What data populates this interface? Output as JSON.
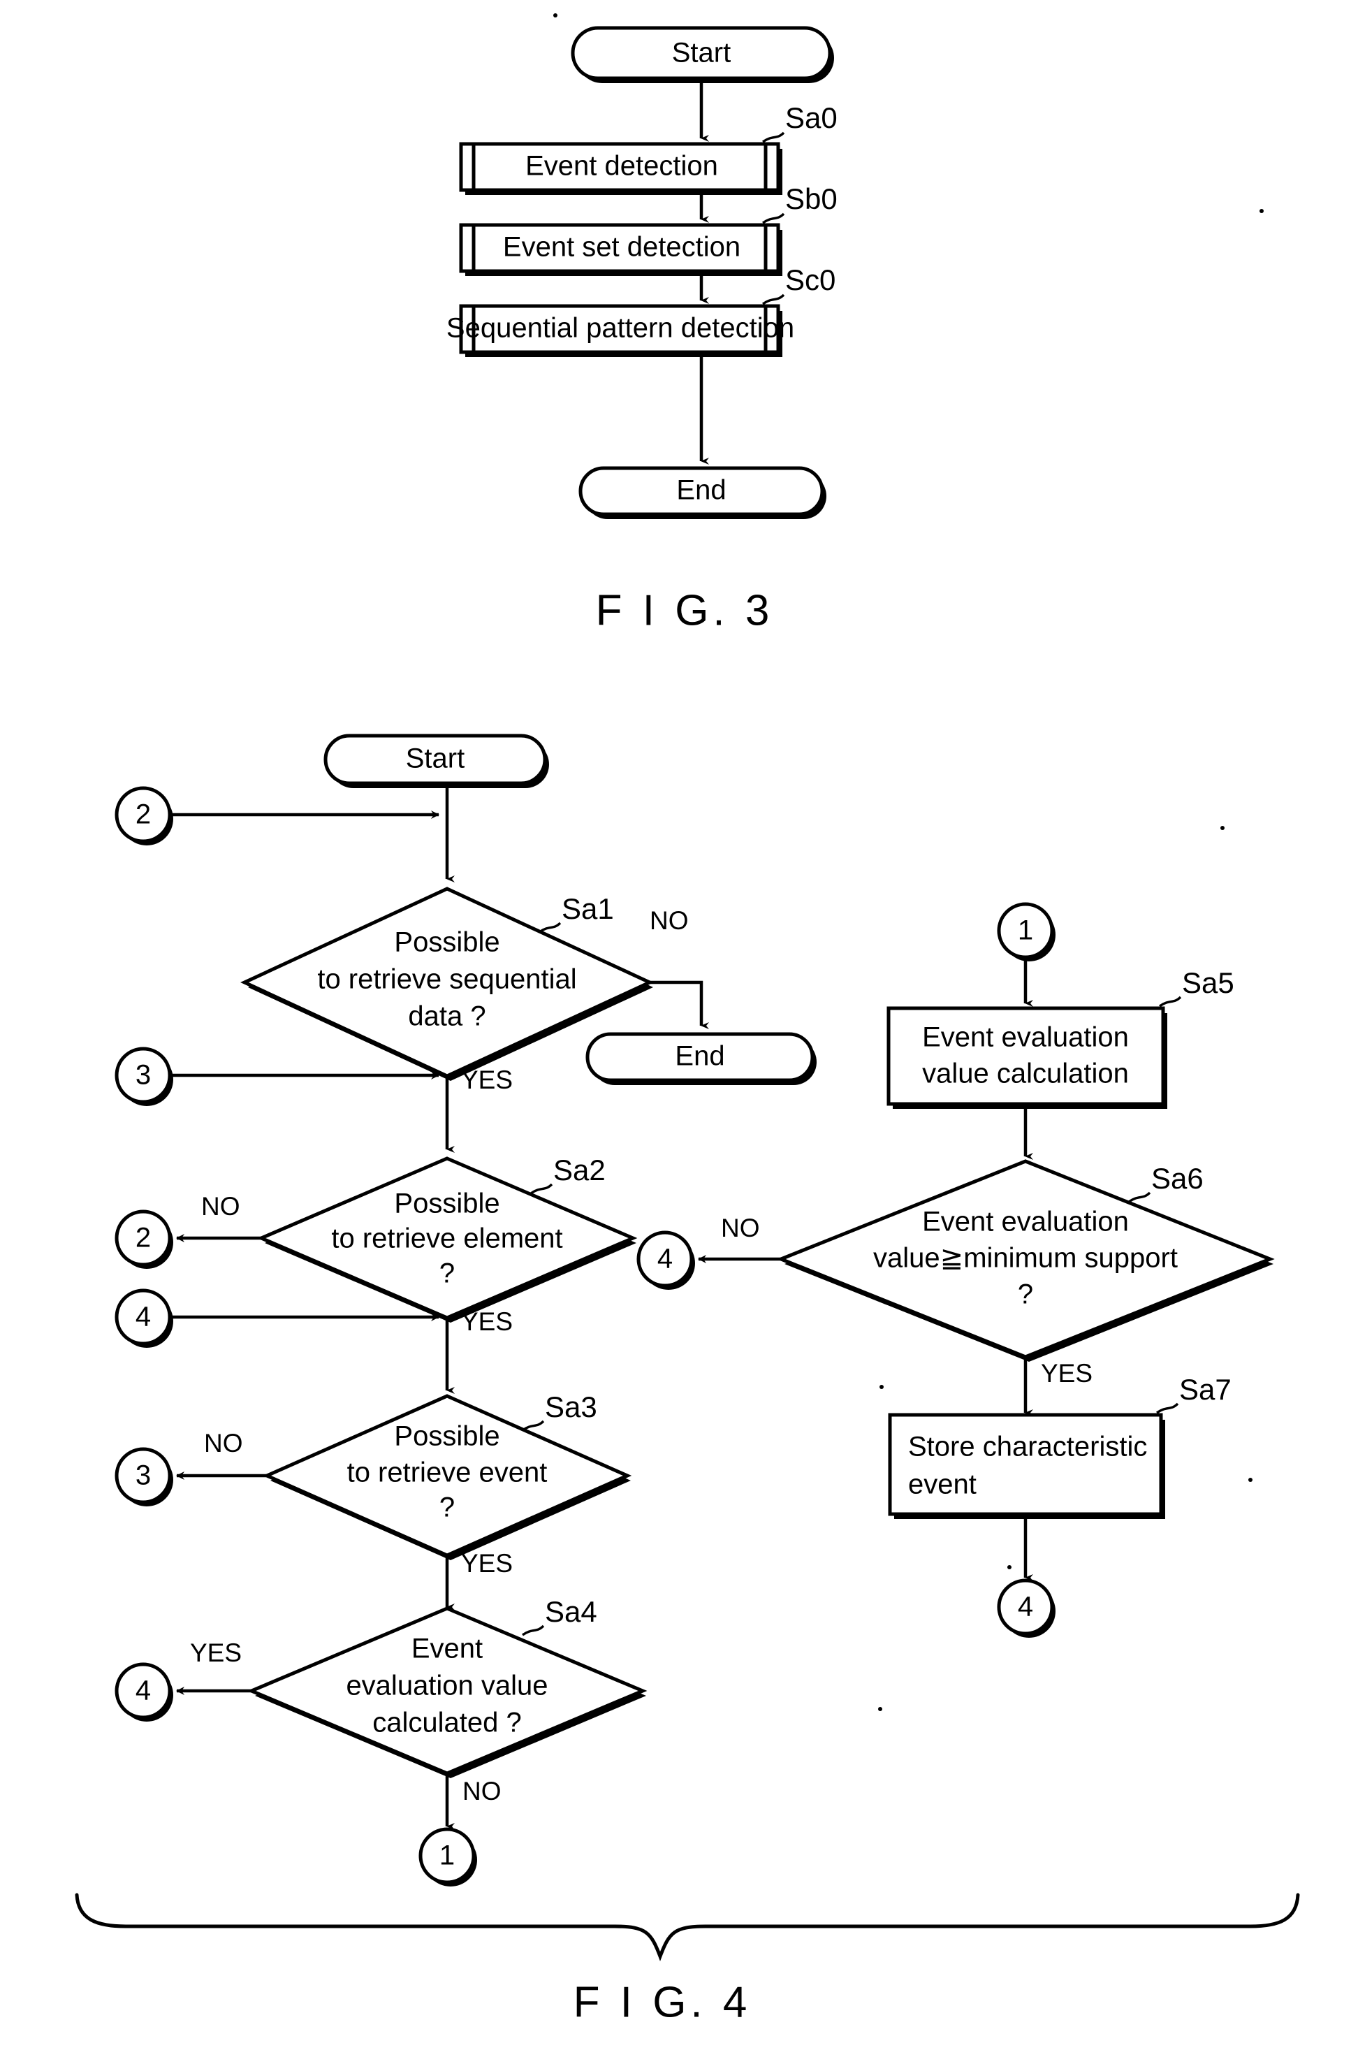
{
  "document": {
    "kind": "patent-drawing-sheet",
    "figures": [
      "FIG. 3",
      "FIG. 4"
    ]
  },
  "fig3": {
    "caption": "F I G. 3",
    "start": "Start",
    "end": "End",
    "steps": [
      {
        "label": "Event detection",
        "tag": "Sa0"
      },
      {
        "label": "Event set detection",
        "tag": "Sb0"
      },
      {
        "label": "Sequential pattern detection",
        "tag": "Sc0"
      }
    ]
  },
  "fig4": {
    "caption": "F I G. 4",
    "start": "Start",
    "end": "End",
    "branch_yes": "YES",
    "branch_no": "NO",
    "decisions": [
      {
        "tag": "Sa1",
        "lines": [
          "Possible",
          "to retrieve sequential",
          "data ?"
        ],
        "yes_target": "Sa2",
        "no_target": "End"
      },
      {
        "tag": "Sa2",
        "lines": [
          "Possible",
          "to retrieve element",
          "?"
        ],
        "yes_target": "Sa3",
        "no_target": "2"
      },
      {
        "tag": "Sa3",
        "lines": [
          "Possible",
          "to retrieve event",
          "?"
        ],
        "yes_target": "Sa4",
        "no_target": "3"
      },
      {
        "tag": "Sa4",
        "lines": [
          "Event",
          "evaluation value",
          "calculated ?"
        ],
        "yes_target": "4",
        "no_target": "1"
      },
      {
        "tag": "Sa6",
        "lines": [
          "Event evaluation",
          "value≧minimum support",
          "?"
        ],
        "yes_target": "Sa7",
        "no_target": "4"
      }
    ],
    "processes": [
      {
        "tag": "Sa5",
        "lines": [
          "Event evaluation",
          "value calculation"
        ]
      },
      {
        "tag": "Sa7",
        "lines": [
          "Store characteristic",
          "event"
        ]
      }
    ],
    "connectors": [
      {
        "id": "conn-2-in",
        "label": "2"
      },
      {
        "id": "conn-3-in",
        "label": "3"
      },
      {
        "id": "conn-4-in",
        "label": "4"
      },
      {
        "id": "conn-2-out",
        "label": "2"
      },
      {
        "id": "conn-3-out",
        "label": "3"
      },
      {
        "id": "conn-4-out-sa4",
        "label": "4"
      },
      {
        "id": "conn-1-out",
        "label": "1"
      },
      {
        "id": "conn-1-in",
        "label": "1"
      },
      {
        "id": "conn-4-out-sa6",
        "label": "4"
      },
      {
        "id": "conn-4-out-sa7",
        "label": "4"
      }
    ]
  }
}
